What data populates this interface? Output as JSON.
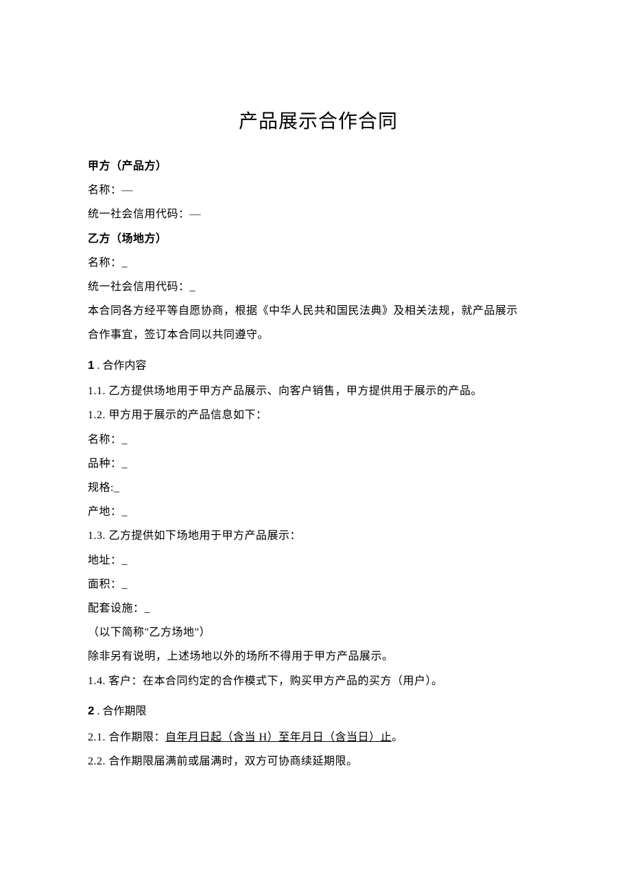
{
  "title": "产品展示合作合同",
  "partyA": {
    "header": "甲方（产品方）",
    "nameLabel": "名称：—",
    "codeLabel": "统一社会信用代码：—"
  },
  "partyB": {
    "header": "乙方（场地方）",
    "nameLabel": "名称：_",
    "codeLabel": "统一社会信用代码：_"
  },
  "preamble1": "本合同各方经平等自愿协商，根据《中华人民共和国民法典》及相关法规，就产品展示",
  "preamble2": "合作事宜，签订本合同以共同遵守。",
  "s1": {
    "num": "1",
    "title": " . 合作内容",
    "c1_1": "1.1.  乙方提供场地用于甲方产品展示、向客户销售，甲方提供用于展示的产品。",
    "c1_2": "1.2.  甲方用于展示的产品信息如下：",
    "name": "名称：_",
    "variety": "品种：_",
    "spec": "规格:_",
    "origin": "产地：_",
    "c1_3": "1.3.  乙方提供如下场地用于甲方产品展示：",
    "address": "地址：_",
    "area": "面积：_",
    "facility": "配套设施：_",
    "nickname": "（以下简称\"乙方场地\"）",
    "restrict": "除非另有说明，上述场地以外的场所不得用于甲方产品展示。",
    "c1_4": "1.4.  客户：在本合同约定的合作模式下，购买甲方产品的买方（用户）。"
  },
  "s2": {
    "num": "2",
    "title": " . 合作期限",
    "c2_1_prefix": "2.1.  合作期限：",
    "c2_1_underline": "自年月日起（含当 H）至年月日（含当日）止",
    "c2_1_suffix": "。",
    "c2_2": "2.2.  合作期限届满前或届满时，双方可协商续延期限。"
  }
}
